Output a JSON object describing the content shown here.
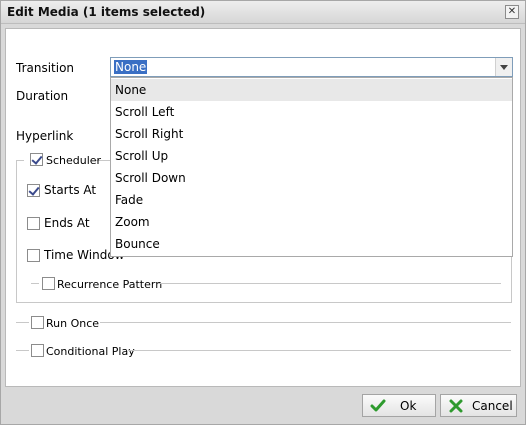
{
  "dialog": {
    "title": "Edit Media (1 items selected)",
    "close_glyph": "✕"
  },
  "form": {
    "transition_label": "Transition",
    "duration_label": "Duration",
    "hyperlink_label": "Hyperlink",
    "transition_value": "None",
    "transition_options": [
      "None",
      "Scroll Left",
      "Scroll Right",
      "Scroll Up",
      "Scroll Down",
      "Fade",
      "Zoom",
      "Bounce"
    ],
    "transition_highlighted": "None"
  },
  "scheduler": {
    "label": "Scheduler",
    "checked": true,
    "starts_at": {
      "label": "Starts At",
      "checked": true
    },
    "ends_at": {
      "label": "Ends At",
      "checked": false
    },
    "time_window": {
      "label": "Time Window",
      "checked": false
    },
    "recurrence": {
      "label": "Recurrence Pattern",
      "checked": false
    }
  },
  "run_once": {
    "label": "Run Once",
    "checked": false
  },
  "conditional_play": {
    "label": "Conditional Play",
    "checked": false
  },
  "footer": {
    "ok_label": "Ok",
    "cancel_label": "Cancel",
    "ok_icon": "check-icon",
    "cancel_icon": "cross-icon"
  },
  "colors": {
    "selection": "#3a6fc4",
    "ok_icon": "#2e9b2e",
    "cancel_icon": "#2f9a2f"
  }
}
